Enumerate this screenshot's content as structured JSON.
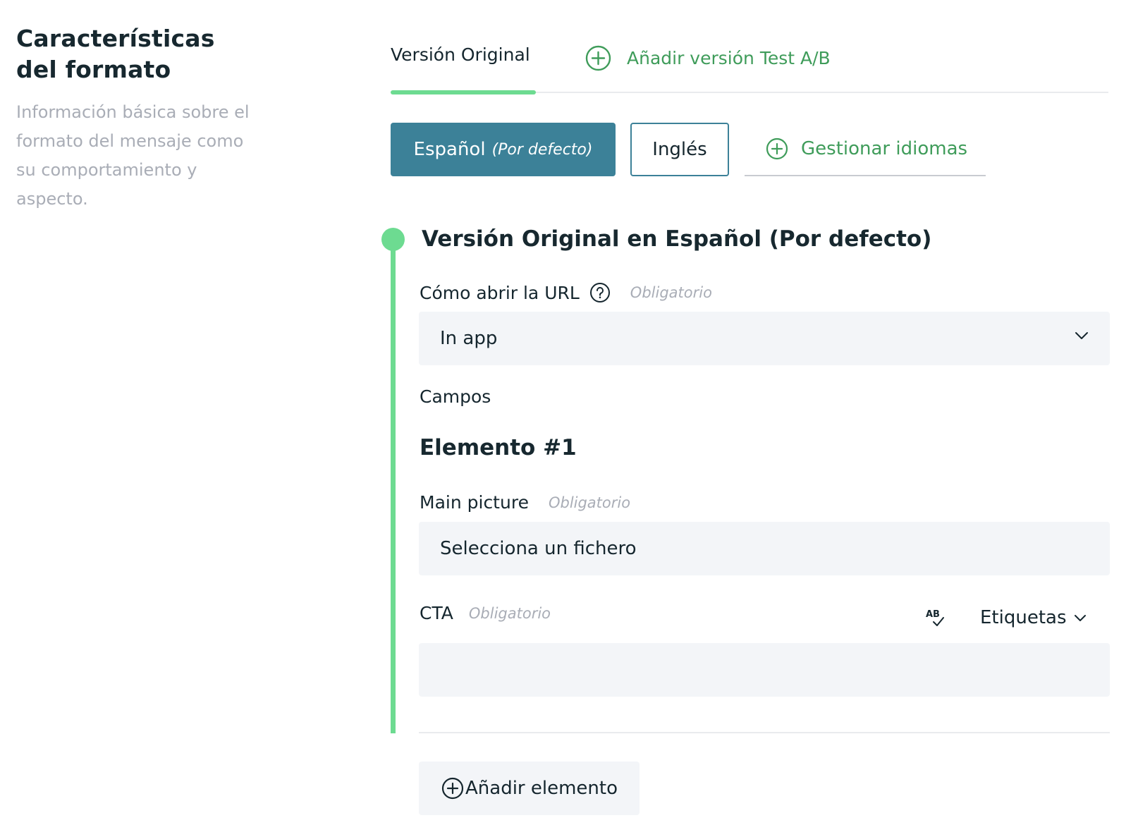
{
  "intro": {
    "title": "Características del formato",
    "description": "Información básica sobre el formato del mensaje como su comportamiento y aspecto."
  },
  "version_tabs": {
    "active": "Versión Original",
    "add_label": "Añadir versión Test A/B"
  },
  "languages": {
    "default_name": "Español",
    "default_tag": "(Por defecto)",
    "secondary": "Inglés",
    "manage_label": "Gestionar idiomas"
  },
  "section": {
    "title": "Versión Original en Español (Por defecto)"
  },
  "fields": {
    "url_label": "Cómo abrir la URL",
    "required": "Obligatorio",
    "url_value": "In app",
    "campos_label": "Campos",
    "element_title": "Elemento #1",
    "picture_label": "Main picture",
    "picture_value": "Selecciona un fichero",
    "cta_label": "CTA",
    "cta_value": "",
    "tags_label": "Etiquetas"
  },
  "actions": {
    "add_element": "Añadir elemento"
  },
  "colors": {
    "accent_green": "#6ddb91",
    "link_green": "#3f9c5a",
    "primary_teal": "#3c8198",
    "field_bg": "#f3f5f8"
  },
  "icons": {
    "add": "plus-circle-icon",
    "help": "question-circle-icon",
    "dropdown": "chevron-down-icon",
    "spellcheck": "spellcheck-icon"
  }
}
